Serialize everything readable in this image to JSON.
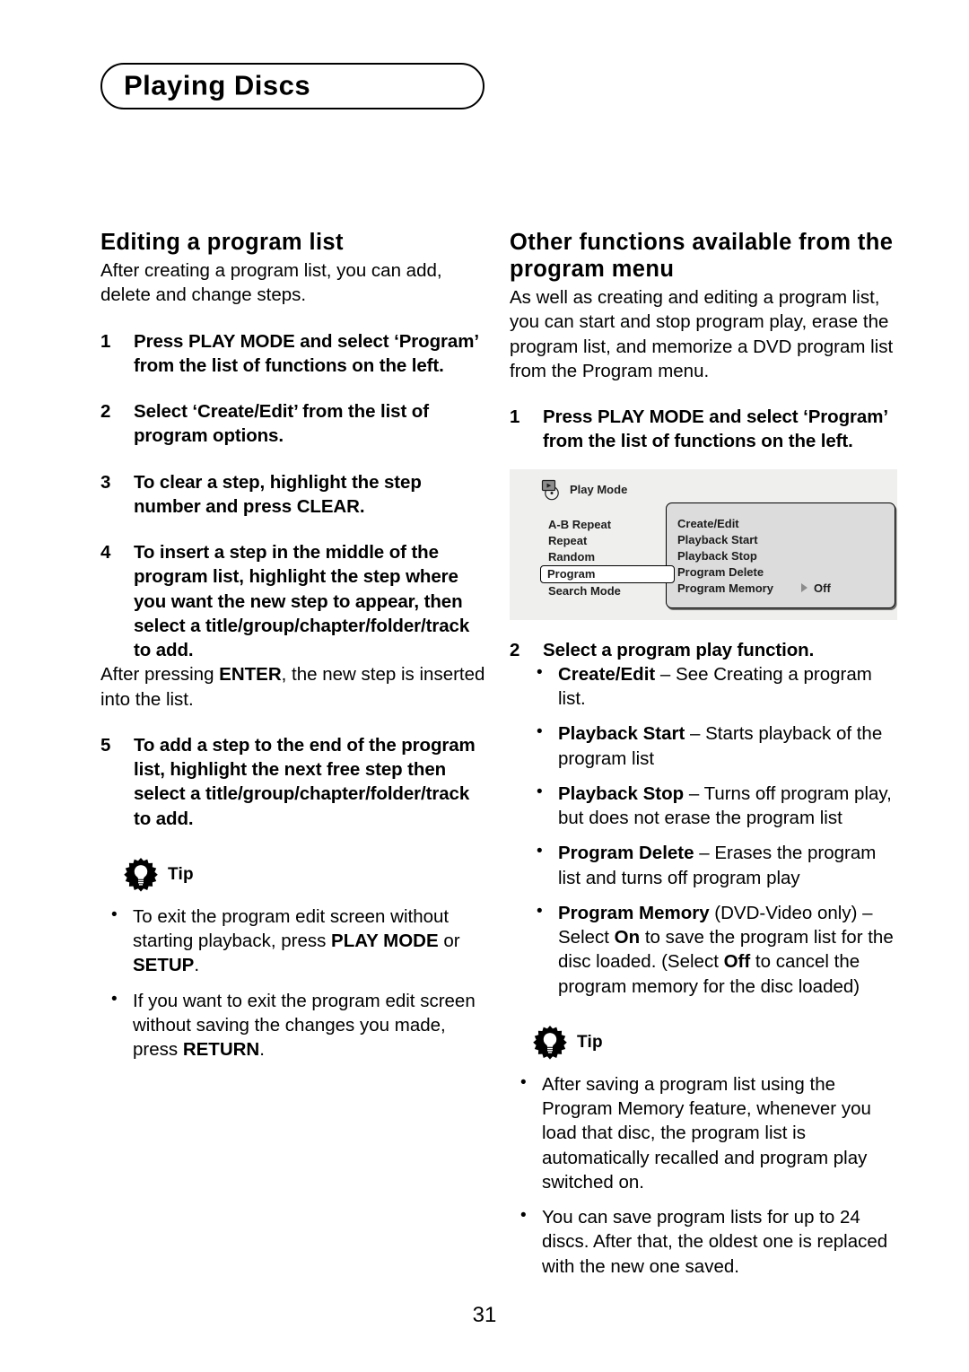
{
  "page": {
    "header_title": "Playing Discs",
    "page_number": "31"
  },
  "left_column": {
    "section_title": "Editing a program list",
    "intro": "After creating a program list, you can add, delete and change steps.",
    "steps": [
      {
        "num": "1",
        "text_html": "Press <b>PLAY MODE</b> and select ‘Program’ from the list of functions on the left."
      },
      {
        "num": "2",
        "text_html": "Select ‘Create/Edit’ from the list of program options."
      },
      {
        "num": "3",
        "text_html": "To clear a step, highlight the step number and press <b>CLEAR</b>."
      },
      {
        "num": "4",
        "text_html": "To insert a step in the middle of the program list, highlight the step where you want the new step to appear, then select a title/group/chapter/folder/track to add."
      },
      {
        "num": "5",
        "text_html": "To add a step to the end of the program list, highlight the next free step then select a title/group/chapter/folder/track to add."
      }
    ],
    "step4_follow_html": "After pressing <b>ENTER</b>, the new step is inserted into the list.",
    "tip": {
      "label": "Tip",
      "icon": "tip-lightbulb-icon",
      "bullets": [
        "To exit the program edit screen without starting playback, press <b>PLAY MODE</b> or <b>SETUP</b>.",
        "If you want to exit the program edit screen without saving the changes you made, press <b>RETURN</b>."
      ]
    }
  },
  "right_column": {
    "section_title": "Other functions available from the program menu",
    "intro": "As well as creating and editing a program list, you can start and stop program play, erase the program list, and memorize a DVD program list from the Program menu.",
    "step1": {
      "num": "1",
      "text_html": "Press <b>PLAY MODE</b> and select ‘Program’ from the list of functions on the left."
    },
    "osd": {
      "icon": "play-mode-disc-icon",
      "header_label": "Play Mode",
      "left_items": [
        {
          "label": "A-B Repeat",
          "selected": false
        },
        {
          "label": "Repeat",
          "selected": false
        },
        {
          "label": "Random",
          "selected": false
        },
        {
          "label": "Program",
          "selected": true
        },
        {
          "label": "Search Mode",
          "selected": false
        }
      ],
      "panel_items": [
        {
          "label": "Create/Edit",
          "value": ""
        },
        {
          "label": "Playback Start",
          "value": ""
        },
        {
          "label": "Playback Stop",
          "value": ""
        },
        {
          "label": "Program Delete",
          "value": ""
        },
        {
          "label": "Program Memory",
          "value": "Off"
        }
      ],
      "colors": {
        "background": "#efefee",
        "panel": "#dcdcdc",
        "selected": "#ffffff"
      }
    },
    "step2": {
      "num": "2",
      "text_html": "Select a program play function."
    },
    "function_bullets": [
      "<b>Create/Edit</b> – See Creating a program list.",
      "<b>Playback Start</b> – Starts playback of the program list",
      "<b>Playback Stop</b> – Turns off program play, but does not erase the program list",
      "<b>Program Delete</b> – Erases the program list and turns off program play",
      "<b>Program Memory</b> (DVD-Video only) – Select <b>On</b> to save the program list for the disc loaded. (Select <b>Off</b> to cancel the program memory for the disc loaded)"
    ],
    "tip": {
      "label": "Tip",
      "icon": "tip-lightbulb-icon",
      "bullets": [
        "After saving a program list using the Program Memory feature, whenever you load that disc, the program list is automatically recalled and program play switched on.",
        "You can save program lists for up to 24 discs. After that, the oldest one is replaced with the new one saved."
      ]
    }
  }
}
